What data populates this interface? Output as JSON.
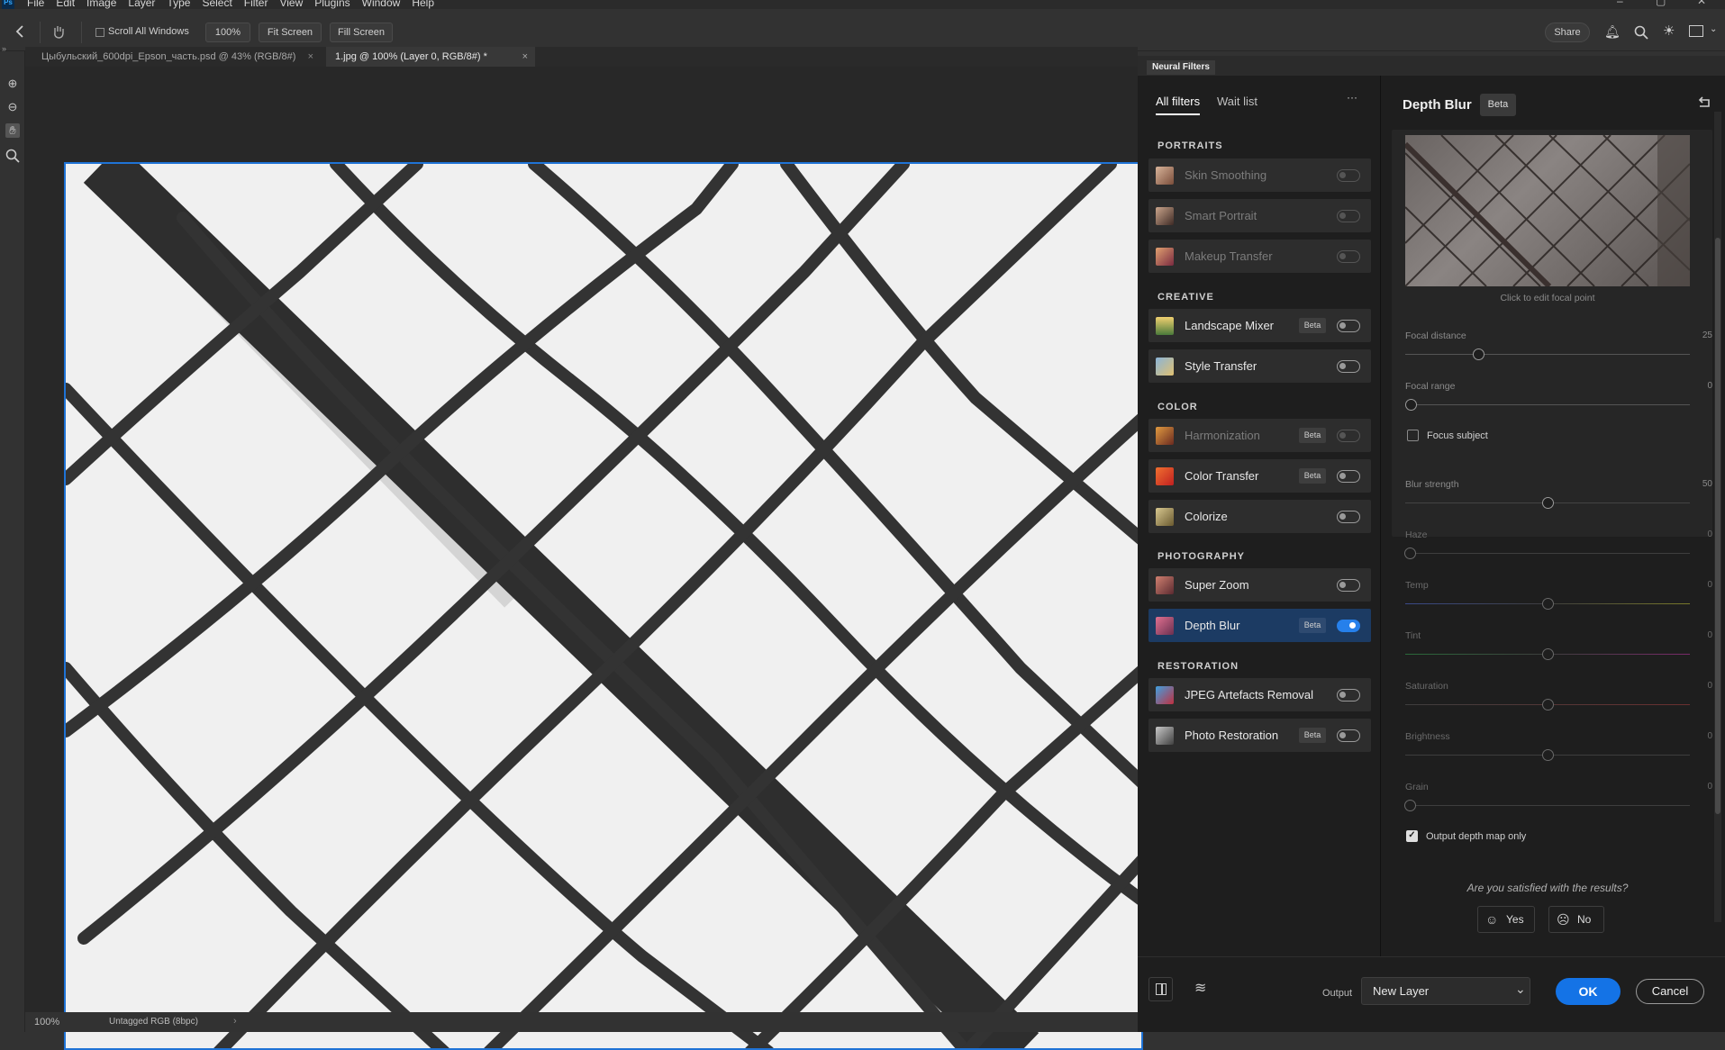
{
  "menubar": {
    "app_icon": "Ps",
    "items": [
      "File",
      "Edit",
      "Image",
      "Layer",
      "Type",
      "Select",
      "Filter",
      "View",
      "Plugins",
      "Window",
      "Help"
    ]
  },
  "options": {
    "scroll_all_windows": "Scroll All Windows",
    "zoom_100": "100%",
    "fit_screen": "Fit Screen",
    "fill_screen": "Fill Screen",
    "share": "Share"
  },
  "tabs": [
    {
      "label": "Цыбульский_600dpi_Epson_часть.psd @ 43% (RGB/8#)"
    },
    {
      "label": "1.jpg @ 100% (Layer 0, RGB/8#) *"
    }
  ],
  "status": {
    "zoom": "100%",
    "profile": "Untagged RGB (8bpc)"
  },
  "neural": {
    "title": "Neural Filters",
    "tab_all": "All filters",
    "tab_wait": "Wait list",
    "more": "···",
    "sections": {
      "portraits": "PORTRAITS",
      "creative": "CREATIVE",
      "color": "COLOR",
      "photography": "PHOTOGRAPHY",
      "restoration": "RESTORATION"
    },
    "filters": {
      "skin_smoothing": "Skin Smoothing",
      "smart_portrait": "Smart Portrait",
      "makeup_transfer": "Makeup Transfer",
      "landscape_mixer": "Landscape Mixer",
      "style_transfer": "Style Transfer",
      "harmonization": "Harmonization",
      "color_transfer": "Color Transfer",
      "colorize": "Colorize",
      "super_zoom": "Super Zoom",
      "depth_blur": "Depth Blur",
      "jpeg_artefacts": "JPEG Artefacts Removal",
      "photo_restoration": "Photo Restoration"
    },
    "beta": "Beta",
    "detail": {
      "title": "Depth Blur",
      "beta": "Beta",
      "preview_caption": "Click to edit focal point",
      "focal_distance": {
        "label": "Focal distance",
        "value": "25"
      },
      "focal_range": {
        "label": "Focal range",
        "value": "0"
      },
      "focus_subject": "Focus subject",
      "blur_strength": {
        "label": "Blur strength",
        "value": "50"
      },
      "haze": {
        "label": "Haze",
        "value": "0"
      },
      "temp": {
        "label": "Temp",
        "value": "0"
      },
      "tint": {
        "label": "Tint",
        "value": "0"
      },
      "saturation": {
        "label": "Saturation",
        "value": "0"
      },
      "brightness": {
        "label": "Brightness",
        "value": "0"
      },
      "grain": {
        "label": "Grain",
        "value": "0"
      },
      "output_depth_map": "Output depth map only",
      "satisfied": "Are you satisfied with the results?",
      "yes": "Yes",
      "no": "No"
    },
    "bottom": {
      "output_label": "Output",
      "output_value": "New Layer",
      "ok": "OK",
      "cancel": "Cancel"
    }
  },
  "colors": {
    "accent": "#1473e6",
    "canvas_border": "#1f73d6"
  }
}
